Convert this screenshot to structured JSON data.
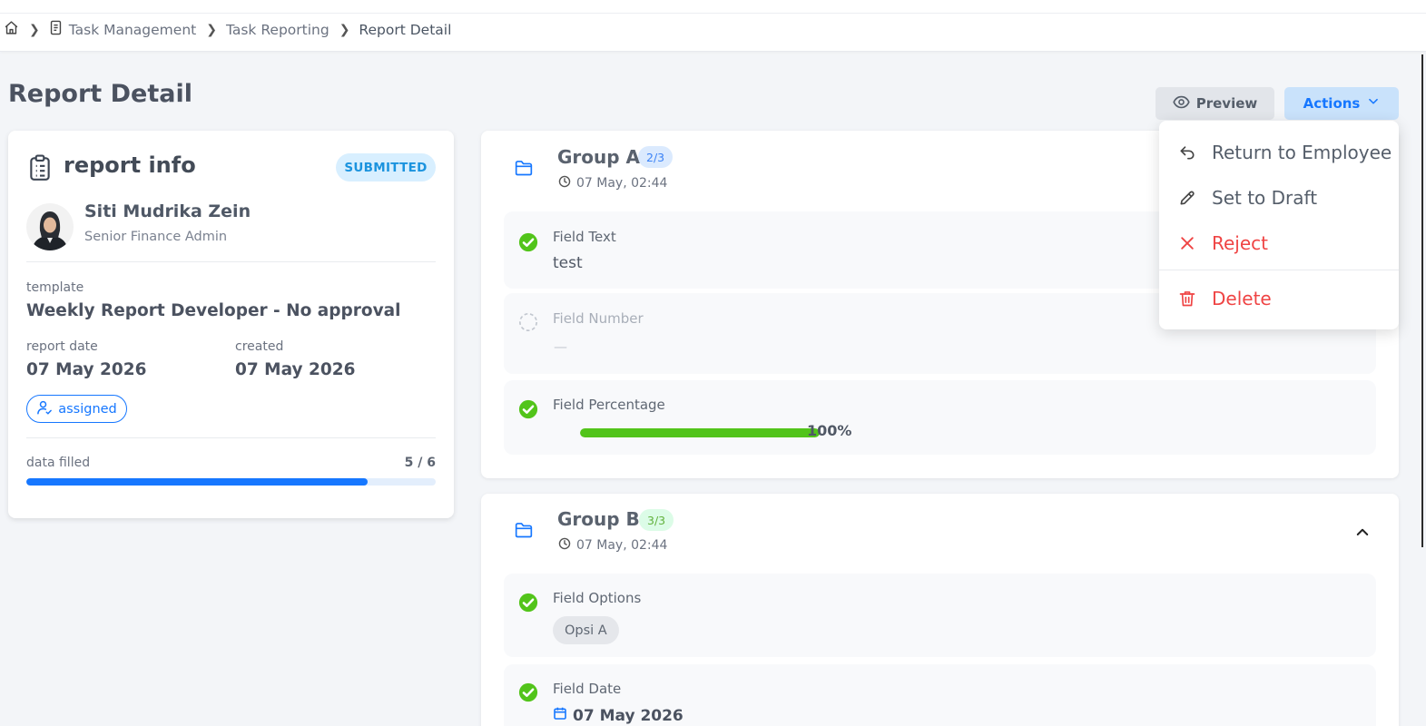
{
  "breadcrumb": {
    "items": [
      "Task Management",
      "Task Reporting",
      "Report Detail"
    ]
  },
  "page": {
    "title": "Report Detail"
  },
  "toolbar": {
    "preview_label": "Preview",
    "actions_label": "Actions"
  },
  "actions_menu": {
    "return_label": "Return to Employee",
    "draft_label": "Set to Draft",
    "reject_label": "Reject",
    "delete_label": "Delete"
  },
  "report_info": {
    "title": "report info",
    "status": "SUBMITTED",
    "employee_name": "Siti Mudrika Zein",
    "employee_role": "Senior Finance Admin",
    "template_label": "template",
    "template_value": "Weekly Report Developer - No approval",
    "report_date_label": "report date",
    "report_date_value": "07 May 2026",
    "created_label": "created",
    "created_value": "07 May 2026",
    "assigned_label": "assigned",
    "data_filled_label": "data filled",
    "data_filled_count": "5 / 6",
    "data_filled_fraction": 0.833
  },
  "groups": [
    {
      "name": "Group A",
      "count": "2/3",
      "time": "07 May, 02:44",
      "fields": [
        {
          "label": "Field Text",
          "value": "test",
          "filled": true
        },
        {
          "label": "Field Number",
          "value": "—",
          "filled": false
        },
        {
          "label": "Field Percentage",
          "value": "100%",
          "percent": 100,
          "filled": true
        }
      ]
    },
    {
      "name": "Group B",
      "count": "3/3",
      "time": "07 May, 02:44",
      "fields": [
        {
          "label": "Field Options",
          "value": "Opsi A",
          "filled": true
        },
        {
          "label": "Field Date",
          "value": "07 May 2026",
          "filled": true
        }
      ]
    }
  ],
  "colors": {
    "primary": "#1677ff",
    "success": "#52c41a",
    "danger": "#ef4444",
    "submitted_badge_bg": "#d8efff"
  }
}
